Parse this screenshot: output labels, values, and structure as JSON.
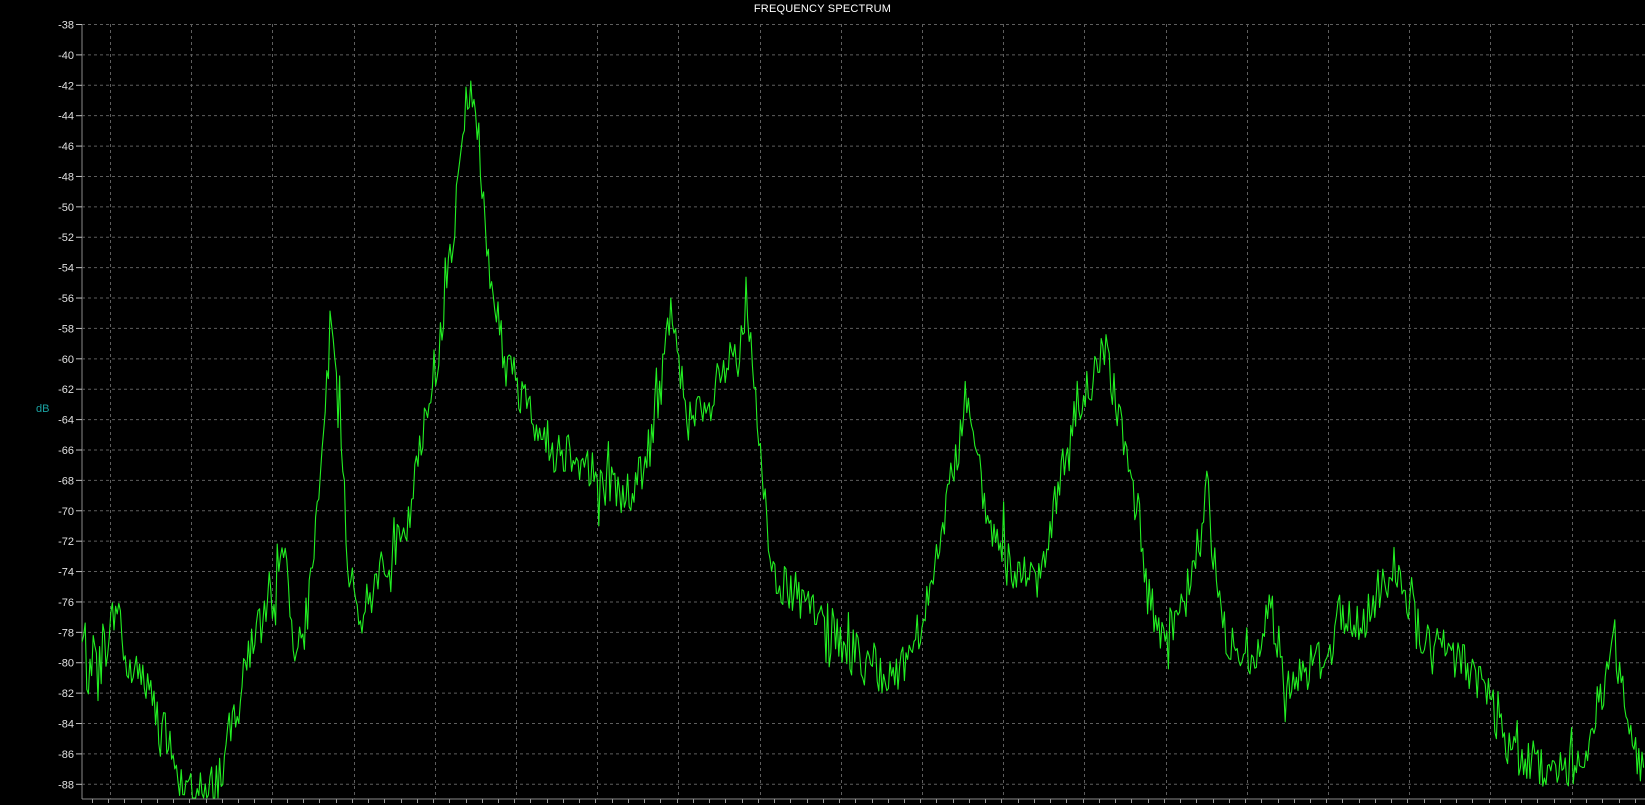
{
  "chart_data": {
    "type": "line",
    "title": "FREQUENCY SPECTRUM",
    "xlabel": "",
    "ylabel": "dB",
    "ylim": [
      -89,
      -38
    ],
    "yticks": [
      -38,
      -40,
      -42,
      -44,
      -46,
      -48,
      -50,
      -52,
      -54,
      -56,
      -58,
      -60,
      -62,
      -64,
      -66,
      -68,
      -70,
      -72,
      -74,
      -76,
      -78,
      -80,
      -82,
      -84,
      -86,
      -88
    ],
    "xlim": [
      0,
      1
    ],
    "grid": true,
    "legend": "none",
    "line_color": "#22ee22",
    "series": [
      {
        "x": [
          0.0,
          0.012,
          0.023,
          0.029,
          0.035,
          0.05,
          0.065,
          0.078,
          0.09,
          0.1,
          0.11,
          0.12,
          0.128,
          0.133,
          0.14,
          0.147,
          0.152,
          0.156,
          0.16,
          0.165,
          0.17,
          0.175,
          0.18,
          0.19,
          0.2,
          0.205,
          0.21,
          0.215,
          0.22,
          0.23,
          0.24,
          0.245,
          0.25,
          0.255,
          0.26,
          0.265,
          0.27,
          0.28,
          0.29,
          0.3,
          0.315,
          0.33,
          0.345,
          0.355,
          0.363,
          0.37,
          0.377,
          0.385,
          0.39,
          0.4,
          0.41,
          0.42,
          0.425,
          0.43,
          0.435,
          0.442,
          0.45,
          0.48,
          0.5,
          0.52,
          0.535,
          0.545,
          0.55,
          0.555,
          0.565,
          0.58,
          0.595,
          0.61,
          0.617,
          0.622,
          0.63,
          0.64,
          0.655,
          0.665,
          0.675,
          0.684,
          0.69,
          0.7,
          0.708,
          0.715,
          0.72,
          0.73,
          0.745,
          0.755,
          0.76,
          0.77,
          0.79,
          0.8,
          0.805,
          0.81,
          0.825,
          0.84,
          0.855,
          0.865,
          0.885,
          0.9,
          0.91,
          0.92,
          0.935,
          0.95,
          0.96,
          0.97,
          0.98,
          0.995,
          1.0
        ],
        "y": [
          -79,
          -80,
          -76,
          -81,
          -80,
          -84,
          -88,
          -89,
          -87,
          -82,
          -78,
          -77,
          -71,
          -77,
          -80,
          -74,
          -68,
          -62,
          -58,
          -65,
          -73,
          -76,
          -77,
          -74,
          -72,
          -72,
          -70,
          -67,
          -64,
          -58,
          -49,
          -44,
          -42,
          -47,
          -53,
          -57,
          -60,
          -62,
          -64,
          -66,
          -66,
          -68,
          -69,
          -68,
          -66,
          -62,
          -56,
          -62,
          -64,
          -64,
          -61,
          -60,
          -56,
          -62,
          -68,
          -74,
          -75,
          -78,
          -80,
          -81,
          -78,
          -74,
          -72,
          -69,
          -63,
          -71,
          -74,
          -75,
          -73,
          -69,
          -67,
          -63,
          -59,
          -65,
          -70,
          -76,
          -78,
          -78,
          -75,
          -72,
          -69,
          -78,
          -80,
          -79,
          -76,
          -81,
          -80,
          -79,
          -77,
          -78,
          -77,
          -73,
          -78,
          -79,
          -80,
          -82,
          -85,
          -86,
          -87,
          -87,
          -86,
          -83,
          -79,
          -86,
          -88
        ]
      }
    ]
  }
}
